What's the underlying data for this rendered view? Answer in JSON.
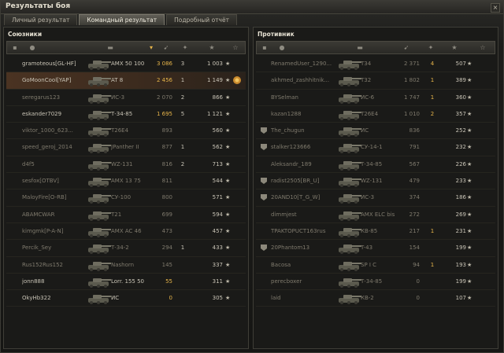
{
  "window": {
    "title": "Результаты боя",
    "close_glyph": "×"
  },
  "tabs": [
    {
      "label": "Личный результат",
      "active": false
    },
    {
      "label": "Командный результат",
      "active": true
    },
    {
      "label": "Подробный отчёт",
      "active": false
    }
  ],
  "header_icons": [
    "platoon-icon",
    "player-icon",
    "tank-icon",
    "sort-arrow-icon",
    "damage-icon",
    "kills-icon",
    "experience-icon",
    "star-icon"
  ],
  "allies": {
    "title": "Союзники",
    "rows": [
      {
        "player": "gramoteous[GL-HF]",
        "tank": "AMX 50 100",
        "damage": "3 086",
        "kills": "3",
        "xp": "1 003",
        "alive": true,
        "style": "normal"
      },
      {
        "player": "GoMoonCool[YAP]",
        "tank": "AT 8",
        "damage": "2 456",
        "kills": "1",
        "xp": "1 149",
        "alive": true,
        "style": "hl",
        "medal": true
      },
      {
        "player": "seregarus123",
        "tank": "ИС-3",
        "damage": "2 070",
        "kills": "2",
        "xp": "866",
        "alive": false,
        "style": "normal"
      },
      {
        "player": "eskander7029",
        "tank": "Т-34-85",
        "damage": "1 695",
        "kills": "5",
        "xp": "1 121",
        "alive": true,
        "style": "normal"
      },
      {
        "player": "viktor_1000_623...",
        "tank": "T26E4",
        "damage": "893",
        "kills": "",
        "xp": "560",
        "alive": false,
        "style": "normal"
      },
      {
        "player": "speed_geroj_2014",
        "tank": "JPanther II",
        "damage": "877",
        "kills": "1",
        "xp": "562",
        "alive": false,
        "style": "normal"
      },
      {
        "player": "d4f5",
        "tank": "WZ-131",
        "damage": "816",
        "kills": "2",
        "xp": "713",
        "alive": false,
        "style": "normal"
      },
      {
        "player": "sesfox[OTBV]",
        "tank": "AMX 13 75",
        "damage": "811",
        "kills": "",
        "xp": "544",
        "alive": false,
        "style": "normal"
      },
      {
        "player": "MaloyFire[O-RB]",
        "tank": "СУ-100",
        "damage": "800",
        "kills": "",
        "xp": "571",
        "alive": false,
        "style": "normal"
      },
      {
        "player": "ABAMCWAR",
        "tank": "T21",
        "damage": "699",
        "kills": "",
        "xp": "594",
        "alive": false,
        "style": "normal"
      },
      {
        "player": "kimgmk[P-A-N]",
        "tank": "AMX AC 46",
        "damage": "473",
        "kills": "",
        "xp": "457",
        "alive": false,
        "style": "normal"
      },
      {
        "player": "Percik_Sey",
        "tank": "Т-34-2",
        "damage": "294",
        "kills": "1",
        "xp": "433",
        "alive": false,
        "style": "normal"
      },
      {
        "player": "Rus152Rus152",
        "tank": "Nashorn",
        "damage": "145",
        "kills": "",
        "xp": "337",
        "alive": false,
        "style": "normal"
      },
      {
        "player": "jonn888",
        "tank": "Lorr. 155 50",
        "damage": "55",
        "kills": "",
        "xp": "311",
        "alive": true,
        "style": "normal"
      },
      {
        "player": "OkyHb322",
        "tank": "ИС",
        "damage": "0",
        "kills": "",
        "xp": "305",
        "alive": true,
        "style": "normal"
      }
    ]
  },
  "enemies": {
    "title": "Противник",
    "rows": [
      {
        "player": "RenamedUser_1290...",
        "tank": "T34",
        "damage": "2 371",
        "kills": "4",
        "xp": "507",
        "alive": false,
        "clan": false
      },
      {
        "player": "akhmed_zashhitnik...",
        "tank": "T32",
        "damage": "1 802",
        "kills": "1",
        "xp": "389",
        "alive": false,
        "clan": false
      },
      {
        "player": "BYSelman",
        "tank": "ИС-6",
        "damage": "1 747",
        "kills": "1",
        "xp": "360",
        "alive": false,
        "clan": false
      },
      {
        "player": "kazan1288",
        "tank": "T26E4",
        "damage": "1 010",
        "kills": "2",
        "xp": "357",
        "alive": false,
        "clan": false
      },
      {
        "player": "The_chugun",
        "tank": "ИС",
        "damage": "836",
        "kills": "",
        "xp": "252",
        "alive": false,
        "clan": true
      },
      {
        "player": "stalker123666",
        "tank": "СУ-14-1",
        "damage": "791",
        "kills": "",
        "xp": "232",
        "alive": false,
        "clan": true
      },
      {
        "player": "Aleksandr_189",
        "tank": "Т-34-85",
        "damage": "567",
        "kills": "",
        "xp": "226",
        "alive": false,
        "clan": false
      },
      {
        "player": "radist2505[BR_U]",
        "tank": "WZ-131",
        "damage": "479",
        "kills": "",
        "xp": "233",
        "alive": false,
        "clan": true
      },
      {
        "player": "20AND10[T_G_W]",
        "tank": "ИС-3",
        "damage": "374",
        "kills": "",
        "xp": "186",
        "alive": false,
        "clan": true
      },
      {
        "player": "dimmjest",
        "tank": "AMX ELC bis",
        "damage": "272",
        "kills": "",
        "xp": "269",
        "alive": false,
        "clan": false
      },
      {
        "player": "TPAKTOPUCT163rus",
        "tank": "КВ-85",
        "damage": "217",
        "kills": "1",
        "xp": "231",
        "alive": false,
        "clan": false
      },
      {
        "player": "20Phantom13",
        "tank": "T-43",
        "damage": "154",
        "kills": "",
        "xp": "199",
        "alive": false,
        "clan": true
      },
      {
        "player": "Bacosa",
        "tank": "SP I C",
        "damage": "94",
        "kills": "1",
        "xp": "193",
        "alive": false,
        "clan": false
      },
      {
        "player": "perecboxer",
        "tank": "Т-34-85",
        "damage": "0",
        "kills": "",
        "xp": "199",
        "alive": false,
        "clan": false
      },
      {
        "player": "laid",
        "tank": "КВ-2",
        "damage": "0",
        "kills": "",
        "xp": "107",
        "alive": false,
        "clan": false
      }
    ]
  },
  "colors": {
    "accent": "#e6b44a",
    "highlight": "#4a3322",
    "text": "#c9c4b6",
    "dead": "#7f7a6d"
  }
}
